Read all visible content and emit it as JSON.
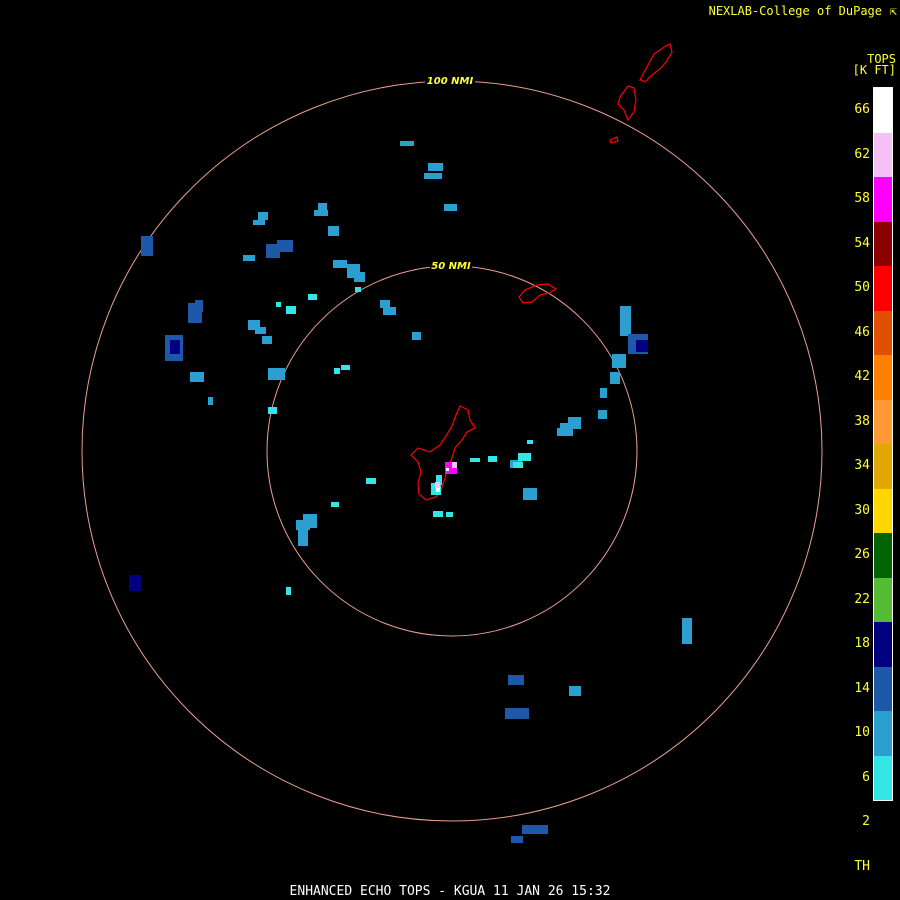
{
  "credit": "NEXLAB-College of DuPage",
  "credit_icon": "arrow-link-icon",
  "footer": "ENHANCED ECHO TOPS - KGUA 11 JAN 26 15:32",
  "legend": {
    "title_line1": "TOPS",
    "title_line2": "[K FT]",
    "levels": [
      {
        "label": "66",
        "color": "#ffffff"
      },
      {
        "label": "62",
        "color": "#f5c0f5"
      },
      {
        "label": "58",
        "color": "#ff00ff"
      },
      {
        "label": "54",
        "color": "#8b0000"
      },
      {
        "label": "50",
        "color": "#ff0000"
      },
      {
        "label": "46",
        "color": "#e05000"
      },
      {
        "label": "42",
        "color": "#ff7f00"
      },
      {
        "label": "38",
        "color": "#ff9933"
      },
      {
        "label": "34",
        "color": "#e0a800"
      },
      {
        "label": "30",
        "color": "#ffd700"
      },
      {
        "label": "26",
        "color": "#006400"
      },
      {
        "label": "22",
        "color": "#55bb33"
      },
      {
        "label": "18",
        "color": "#000080"
      },
      {
        "label": "14",
        "color": "#1e58a8"
      },
      {
        "label": "10",
        "color": "#2b9fcf"
      },
      {
        "label": "6",
        "color": "#33e5e5"
      },
      {
        "label": "2",
        "color": "#000000"
      },
      {
        "label": "TH",
        "color": "#000000"
      }
    ]
  },
  "range_rings": [
    {
      "label": "100 NMI"
    },
    {
      "label": "50 NMI"
    }
  ],
  "colors": {
    "ring": "#e8a090",
    "coast": "#ff0000",
    "label": "#ffff33"
  }
}
